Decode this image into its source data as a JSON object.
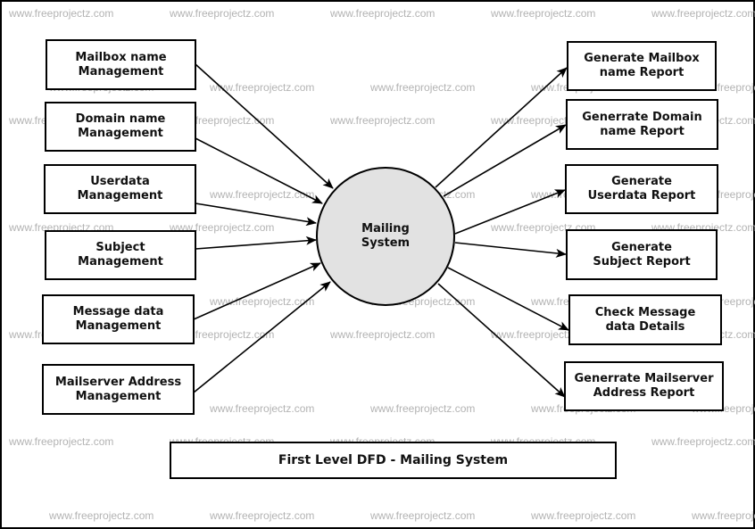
{
  "diagram": {
    "type": "data-flow-diagram",
    "process": {
      "label": "Mailing\nSystem",
      "fill": "#e2e2e2"
    },
    "inputs": [
      {
        "label": "Mailbox name\nManagement"
      },
      {
        "label": "Domain name\nManagement"
      },
      {
        "label": "Userdata\nManagement"
      },
      {
        "label": "Subject\nManagement"
      },
      {
        "label": "Message data\nManagement"
      },
      {
        "label": "Mailserver Address\nManagement"
      }
    ],
    "outputs": [
      {
        "label": "Generate Mailbox\nname Report"
      },
      {
        "label": "Generrate Domain\nname Report"
      },
      {
        "label": "Generate\nUserdata Report"
      },
      {
        "label": "Generate\nSubject Report"
      },
      {
        "label": "Check Message\ndata Details"
      },
      {
        "label": "Generrate Mailserver\nAddress Report"
      }
    ],
    "flows": [
      {
        "from": "Mailbox name Management",
        "to": "Mailing System"
      },
      {
        "from": "Domain name Management",
        "to": "Mailing System"
      },
      {
        "from": "Userdata Management",
        "to": "Mailing System"
      },
      {
        "from": "Subject Management",
        "to": "Mailing System"
      },
      {
        "from": "Message data Management",
        "to": "Mailing System"
      },
      {
        "from": "Mailserver Address Management",
        "to": "Mailing System"
      },
      {
        "from": "Mailing System",
        "to": "Generate Mailbox name Report"
      },
      {
        "from": "Mailing System",
        "to": "Generrate Domain name Report"
      },
      {
        "from": "Mailing System",
        "to": "Generate Userdata Report"
      },
      {
        "from": "Mailing System",
        "to": "Generate Subject Report"
      },
      {
        "from": "Mailing System",
        "to": "Check Message data Details"
      },
      {
        "from": "Mailing System",
        "to": "Generrate Mailserver Address Report"
      }
    ],
    "caption": "First Level DFD - Mailing System",
    "watermark": "www.freeprojectz.com"
  }
}
